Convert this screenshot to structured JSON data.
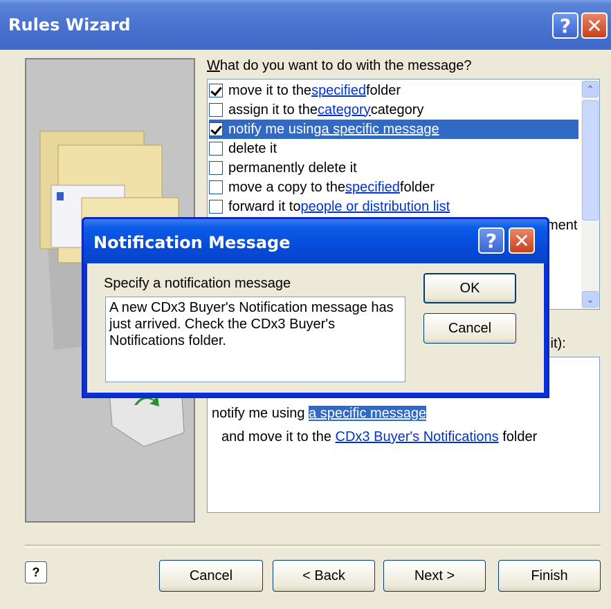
{
  "window": {
    "title": "Rules Wizard"
  },
  "prompt_label": "What do you want to do with the message?",
  "actions": [
    {
      "pre": "move it to the ",
      "link": "specified",
      "post": " folder",
      "checked": true,
      "selected": false
    },
    {
      "pre": "assign it to the ",
      "link": "category",
      "post": " category",
      "checked": false,
      "selected": false
    },
    {
      "pre": "notify me using ",
      "link": "a specific message",
      "post": "",
      "checked": true,
      "selected": true
    },
    {
      "pre": "delete it",
      "link": "",
      "post": "",
      "checked": false,
      "selected": false
    },
    {
      "pre": "permanently delete it",
      "link": "",
      "post": "",
      "checked": false,
      "selected": false
    },
    {
      "pre": "move a copy to the ",
      "link": "specified",
      "post": " folder",
      "checked": false,
      "selected": false
    },
    {
      "pre": "forward it to ",
      "link": "people or distribution list",
      "post": "",
      "checked": false,
      "selected": false
    }
  ],
  "partial_texts": {
    "ment": "ment",
    "edit": "it it):"
  },
  "description": {
    "line1_pre": "notify me using ",
    "line1_link": "a specific message",
    "line2_pre": "and move it to the ",
    "line2_link": "CDx3 Buyer's Notifications",
    "line2_post": " folder"
  },
  "buttons": {
    "cancel": "Cancel",
    "back": "< Back",
    "next": "Next >",
    "finish": "Finish"
  },
  "dialog": {
    "title": "Notification Message",
    "label": "Specify a notification message",
    "message": "A new CDx3 Buyer's Notification message has just arrived.  Check the CDx3 Buyer's Notifications folder.",
    "ok": "OK",
    "cancel": "Cancel"
  },
  "colors": {
    "titlebar": "#3f69c6",
    "dialog_title": "#0648d6",
    "selection": "#316ac5",
    "link": "#0033cc"
  }
}
